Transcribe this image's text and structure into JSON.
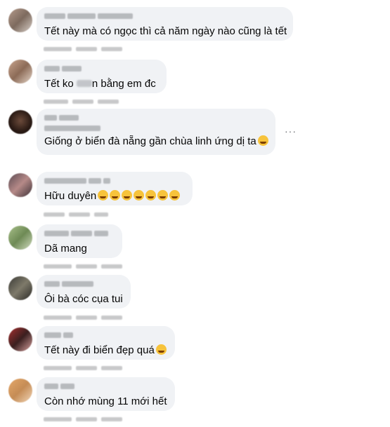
{
  "comments": [
    {
      "text": "Tết này mà có ngọc thì cả năm ngày nào cũng là tết"
    },
    {
      "text_before": "Tết ko",
      "text_after": "n bằng em đc"
    },
    {
      "text": "Giống ở biển đà nẵng gần chùa linh ứng dị ta"
    },
    {
      "text": "Hữu duyên"
    },
    {
      "text": "Dã mang"
    },
    {
      "text": "Ôi bà cóc cụa tui"
    },
    {
      "text": "Tết này đi biển đẹp quá"
    },
    {
      "text": "Còn nhớ mùng 11 mới hết"
    }
  ],
  "more_icon": "···",
  "colors": {
    "bubble": "#f0f2f5",
    "text": "#050505",
    "meta": "#65676b"
  },
  "icons": [
    "rolling-eyes-emoji",
    "laughing-crying-emoji",
    "kissing-emoji",
    "more-options-icon"
  ]
}
